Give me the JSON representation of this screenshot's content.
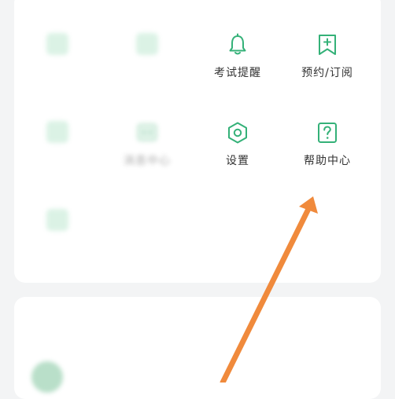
{
  "colors": {
    "accent": "#34b178",
    "annotation_arrow": "#f08a3c",
    "background": "#f3f4f5",
    "card": "#ffffff"
  },
  "grid": {
    "row1": [
      {
        "label": "",
        "icon": "blurred-icon"
      },
      {
        "label": "",
        "icon": "blurred-icon"
      },
      {
        "label": "考试提醒",
        "icon": "bell-icon"
      },
      {
        "label": "预约/订阅",
        "icon": "bookmark-plus-icon"
      }
    ],
    "row2": [
      {
        "label": "",
        "icon": "blurred-icon"
      },
      {
        "label": "消息中心",
        "icon": "message-icon"
      },
      {
        "label": "设置",
        "icon": "hexagon-settings-icon"
      },
      {
        "label": "帮助中心",
        "icon": "question-icon"
      }
    ],
    "row3": [
      {
        "label": "",
        "icon": "blurred-icon"
      }
    ]
  },
  "recommend": {
    "title": "",
    "item_text": ""
  }
}
